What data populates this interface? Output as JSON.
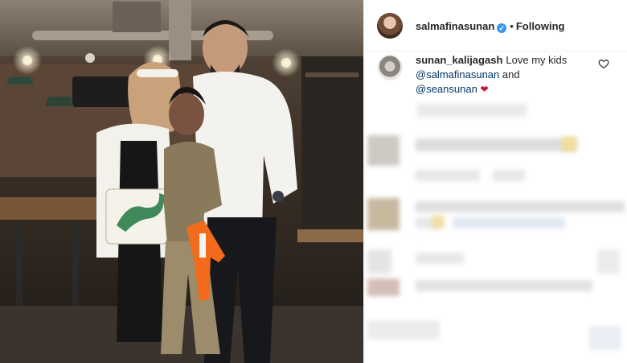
{
  "post": {
    "photo_alt": "",
    "owner": {
      "username": "salmafinasunan",
      "verified": true,
      "follow_status": "Following"
    },
    "comments": [
      {
        "username": "sunan_kalijagash",
        "text": "Love my kids",
        "mention_1": "@salmafinasunan",
        "joiner": "and",
        "mention_2": "@seansunan",
        "emoji": "❤"
      }
    ]
  },
  "colors": {
    "link": "#003569",
    "verified_badge": "#3897f0",
    "heart": "#c8102e",
    "border": "#efefef"
  },
  "icons": {
    "verified": "verified-badge-icon",
    "like": "heart-outline-icon"
  }
}
